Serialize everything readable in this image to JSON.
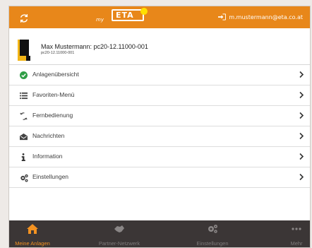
{
  "header": {
    "refresh_icon": "refresh-icon",
    "logo": {
      "prefix": "my",
      "brand": "ETA"
    },
    "user_icon": "sign-in-icon",
    "user_email": "m.mustermann@eta.co.at"
  },
  "device": {
    "icon": "boiler-icon",
    "title": "Max Mustermann: pc20-12.11000-001",
    "subtitle": "pc20-12.11000-001"
  },
  "menu": {
    "items": [
      {
        "icon": "check-circle-icon",
        "label": "Anlagenübersicht"
      },
      {
        "icon": "list-icon",
        "label": "Favoriten-Menü"
      },
      {
        "icon": "remote-control-icon",
        "label": "Fernbedienung"
      },
      {
        "icon": "envelope-icon",
        "label": "Nachrichten"
      },
      {
        "icon": "info-icon",
        "label": "Information"
      },
      {
        "icon": "cogs-icon",
        "label": "Einstellungen"
      }
    ]
  },
  "bottom_nav": {
    "tabs": [
      {
        "icon": "home-icon",
        "label": "Meine Anlagen",
        "active": true
      },
      {
        "icon": "handshake-icon",
        "label": "Partner-Netzwerk",
        "active": false
      },
      {
        "icon": "cogs-icon",
        "label": "Einstellungen",
        "active": false
      },
      {
        "icon": "more-icon",
        "label": "Mehr",
        "active": false
      }
    ]
  },
  "colors": {
    "accent": "#e8871a",
    "active_tab": "#f39221",
    "bottom_bar": "#3b3636",
    "success": "#2f9e46"
  }
}
